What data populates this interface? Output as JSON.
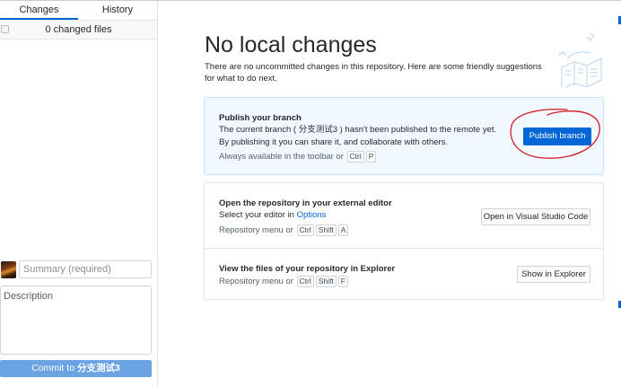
{
  "sidebar": {
    "tabs": {
      "changes": "Changes",
      "history": "History"
    },
    "changed_files_label": "0 changed files",
    "summary_placeholder": "Summary (required)",
    "description_placeholder": "Description",
    "commit_button": {
      "prefix": "Commit to ",
      "branch": "分支测试3"
    }
  },
  "main": {
    "title": "No local changes",
    "subtitle": "There are no uncommitted changes in this repository. Here are some friendly suggestions for what to do next.",
    "publish": {
      "title": "Publish your branch",
      "description": "The current branch ( 分支测试3 ) hasn't been published to the remote yet. By publishing it you can share it, and collaborate with others.",
      "hint_text": "Always available in the toolbar or",
      "shortcut": [
        "Ctrl",
        "P"
      ],
      "button": "Publish branch"
    },
    "editor": {
      "title": "Open the repository in your external editor",
      "line_text": "Select your editor in",
      "line_link": "Options",
      "hint_text": "Repository menu or",
      "shortcut": [
        "Ctrl",
        "Shift",
        "A"
      ],
      "button": "Open in Visual Studio Code"
    },
    "explorer": {
      "title": "View the files of your repository in Explorer",
      "hint_text": "Repository menu or",
      "shortcut": [
        "Ctrl",
        "Shift",
        "F"
      ],
      "button": "Show in Explorer"
    }
  },
  "colors": {
    "accent": "#0366d6",
    "commit_button": "#6aa4e2",
    "publish_panel_bg": "#f1f8ff",
    "annotation_scribble": "#d01b24"
  },
  "icons": {
    "select_all": "checkbox-icon",
    "illustration": "empty-repository-illustration",
    "avatar": "user-avatar"
  }
}
